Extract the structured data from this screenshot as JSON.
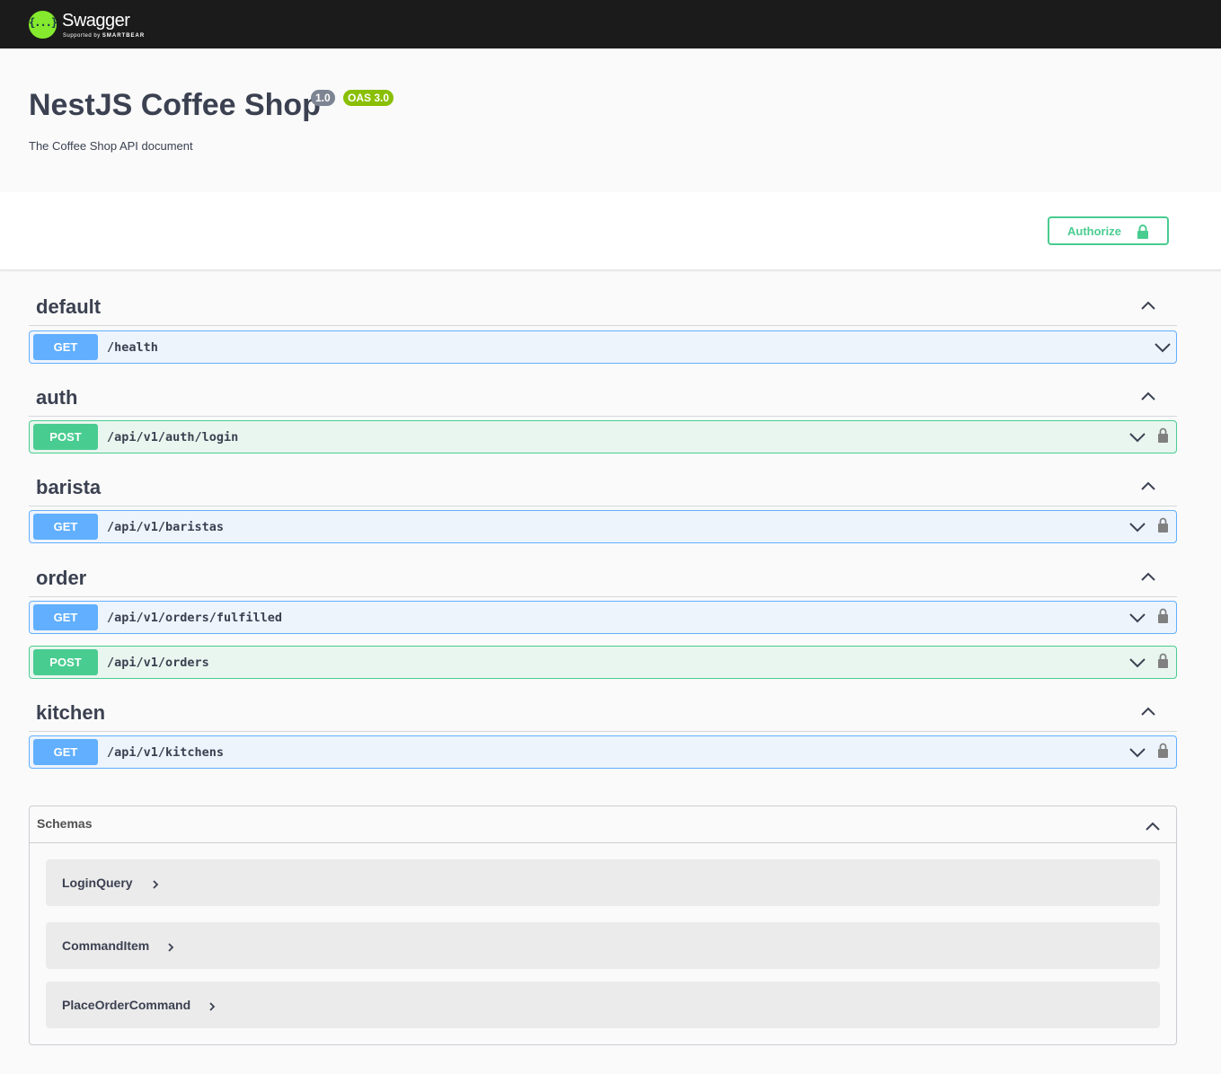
{
  "topbar": {
    "logo_mark": "{...}",
    "logo_title": "Swagger",
    "logo_sub_prefix": "Supported by",
    "logo_sub_brand": "SMARTBEAR"
  },
  "info": {
    "title": "NestJS Coffee Shop",
    "version": "1.0",
    "oas": "OAS 3.0",
    "description": "The Coffee Shop API document"
  },
  "authorize": {
    "label": "Authorize",
    "icon": "lock-icon"
  },
  "tags": [
    {
      "name": "default",
      "operations": [
        {
          "method": "GET",
          "path": "/health",
          "locked": false
        }
      ]
    },
    {
      "name": "auth",
      "operations": [
        {
          "method": "POST",
          "path": "/api/v1/auth/login",
          "locked": true
        }
      ]
    },
    {
      "name": "barista",
      "operations": [
        {
          "method": "GET",
          "path": "/api/v1/baristas",
          "locked": true
        }
      ]
    },
    {
      "name": "order",
      "operations": [
        {
          "method": "GET",
          "path": "/api/v1/orders/fulfilled",
          "locked": true
        },
        {
          "method": "POST",
          "path": "/api/v1/orders",
          "locked": true
        }
      ]
    },
    {
      "name": "kitchen",
      "operations": [
        {
          "method": "GET",
          "path": "/api/v1/kitchens",
          "locked": true
        }
      ]
    }
  ],
  "schemas": {
    "title": "Schemas",
    "models": [
      {
        "name": "LoginQuery"
      },
      {
        "name": "CommandItem"
      },
      {
        "name": "PlaceOrderCommand"
      }
    ]
  },
  "colors": {
    "get": "#61affe",
    "post": "#49cc90",
    "topbar": "#1b1b1b",
    "logo": "#85ea2d",
    "oas_badge": "#89bf04",
    "version_badge": "#7d8492"
  }
}
